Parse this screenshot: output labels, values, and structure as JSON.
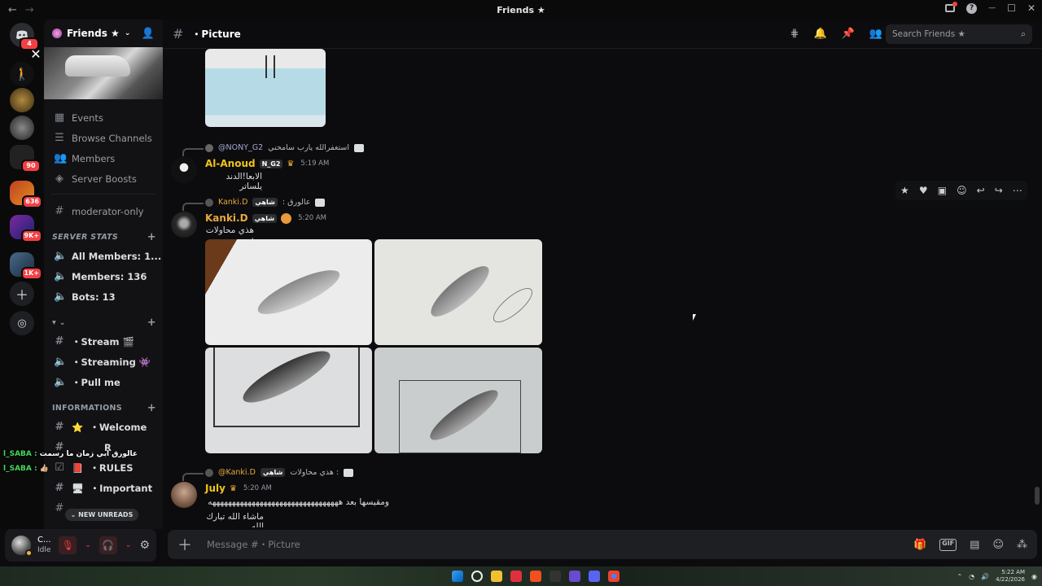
{
  "window": {
    "title": "Friends ★",
    "back_glyph": "←",
    "forward_glyph": "→",
    "help_glyph": "?",
    "minimize_glyph": "—",
    "maximize_glyph": "☐",
    "close_glyph": "✕"
  },
  "rail": {
    "badges": [
      "4",
      "90",
      "636",
      "9K+",
      "1K+"
    ]
  },
  "server": {
    "name": "Friends ★",
    "channels": [
      {
        "icon": "calendar-icon",
        "label": "Events",
        "bold": false
      },
      {
        "icon": "browse-icon",
        "label": "Browse Channels",
        "bold": false
      },
      {
        "icon": "members-icon",
        "label": "Members",
        "bold": false
      },
      {
        "icon": "boost-icon",
        "label": "Server Boosts",
        "bold": false
      }
    ],
    "moderator_channel": "moderator-only",
    "stats_category": "SERVER STATS",
    "stats_channels": [
      "All Members: 1...",
      "Members: 136",
      "Bots: 13"
    ],
    "group_channels": [
      "・Stream 🎬",
      "・Streaming 👾",
      "・Pull me"
    ],
    "info_category": "INFORMATIONS",
    "info_channels": [
      "・Welcome",
      "R",
      "・RULES",
      "・Important"
    ],
    "new_unreads": "NEW UNREADS"
  },
  "user": {
    "name": "C...",
    "status": "Idle"
  },
  "overlay": [
    {
      "name": "l_SABA :",
      "text": "عالورق ابي زمان ما رسمت"
    },
    {
      "name": "l_SABA :",
      "text": "👍🏼"
    }
  ],
  "header": {
    "channel": "・Picture",
    "search_placeholder": "Search Friends ★"
  },
  "messages": [
    {
      "reply_mention": "@NONY_G2",
      "reply_text": "استغفرالله يارب سامحني",
      "author": "Al-Anoud",
      "author_color": "#f0c419",
      "tag": "N_G2",
      "time": "5:19 AM",
      "text": "الابعا!الدند يلساتر"
    },
    {
      "reply_mention": "Kanki.D",
      "reply_text": ": عالورق",
      "reply_tag": "شاهي",
      "author": "Kanki.D",
      "author_color": "#e8a93c",
      "tag": "شاهي",
      "time": "5:20 AM",
      "text": "هذي محاولات :"
    },
    {
      "reply_mention": "@Kanki.D",
      "reply_text": "هذي محاولات :",
      "reply_tag": "شاهي",
      "author": "July",
      "author_color": "#f0c419",
      "time": "5:20 AM",
      "text_lines": [
        "ومقيسها بعد هههههههههههههههههههههههههههههههههه",
        "ماشاء الله تبارك الله"
      ]
    }
  ],
  "composer": {
    "placeholder": "Message #・Picture",
    "gif_label": "GIF"
  },
  "taskbar": {
    "time": "5:22 AM",
    "date": "4/22/2026"
  },
  "colors": {
    "accent": "#5865f2",
    "danger": "#f23f43",
    "background": "#0c0c0e"
  }
}
